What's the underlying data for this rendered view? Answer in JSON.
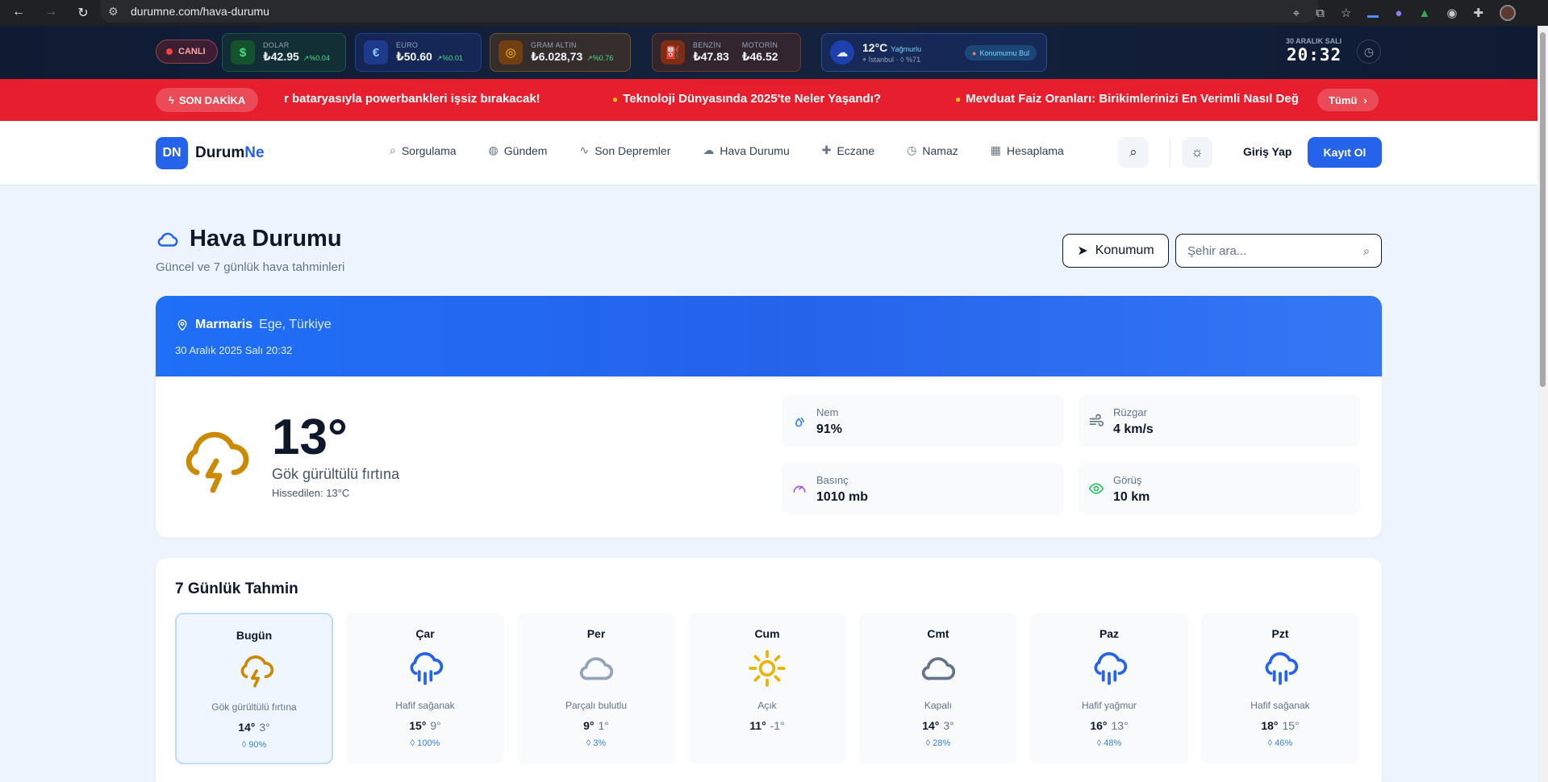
{
  "browser": {
    "url": "durumne.com/hava-durumu"
  },
  "ticker": {
    "live_label": "CANLI",
    "dollar": {
      "label": "DOLAR",
      "value": "₺42.95",
      "change": "%0.04",
      "symbol": "$"
    },
    "euro": {
      "label": "EURO",
      "value": "₺50.60",
      "change": "%0.01",
      "symbol": "€"
    },
    "gold": {
      "label": "GRAM ALTIN",
      "value": "₺6.028,73",
      "change": "%0.76"
    },
    "benzin": {
      "label": "BENZİN",
      "value": "₺47.83"
    },
    "motorin": {
      "label": "MOTORİN",
      "value": "₺46.52"
    },
    "weather": {
      "temp": "12°C",
      "condition": "Yağmurlu",
      "city": "İstanbul",
      "humidity": "%71",
      "locate_label": "Konumumu Bul"
    },
    "date": "30 ARALIK SALI",
    "time": "20:32"
  },
  "breaking": {
    "label": "SON DAKİKA",
    "items": [
      "r bataryasıyla powerbankleri işsiz bırakacak!",
      "Teknoloji Dünyasında 2025'te Neler Yaşandı?",
      "Mevduat Faiz Oranları: Birikimlerinizi En Verimli Nasıl Değ"
    ],
    "all_label": "Tümü"
  },
  "header": {
    "logo_mark": "DN",
    "logo_a": "Durum",
    "logo_b": "Ne",
    "nav": [
      "Sorgulama",
      "Gündem",
      "Son Depremler",
      "Hava Durumu",
      "Eczane",
      "Namaz",
      "Hesaplama"
    ],
    "login": "Giriş Yap",
    "register": "Kayıt Ol"
  },
  "page": {
    "title": "Hava Durumu",
    "subtitle": "Güncel ve 7 günlük hava tahminleri",
    "location_button": "Konumum",
    "search_placeholder": "Şehir ara..."
  },
  "current": {
    "city": "Marmaris",
    "region": "Ege, Türkiye",
    "datetime": "30 Aralık 2025 Salı 20:32",
    "temp": "13°",
    "condition": "Gök gürültülü fırtına",
    "feels_like": "Hissedilen: 13°C",
    "stats": {
      "humidity": {
        "label": "Nem",
        "value": "91%"
      },
      "wind": {
        "label": "Rüzgar",
        "value": "4 km/s"
      },
      "pressure": {
        "label": "Basınç",
        "value": "1010 mb"
      },
      "visibility": {
        "label": "Görüş",
        "value": "10 km"
      }
    },
    "colors": {
      "header_blue": "#2563eb",
      "storm_icon": "#ca8a04"
    }
  },
  "forecast": {
    "title": "7 Günlük Tahmin",
    "days": [
      {
        "day": "Bugün",
        "icon": "storm-icon",
        "condition": "Gök gürültülü fırtına",
        "high": "14°",
        "low": "3°",
        "rain": "90%"
      },
      {
        "day": "Çar",
        "icon": "rain-cloud-icon",
        "condition": "Hafif sağanak",
        "high": "15°",
        "low": "9°",
        "rain": "100%"
      },
      {
        "day": "Per",
        "icon": "cloud-icon",
        "condition": "Parçalı bulutlu",
        "high": "9°",
        "low": "1°",
        "rain": "3%"
      },
      {
        "day": "Cum",
        "icon": "sun-icon",
        "condition": "Açık",
        "high": "11°",
        "low": "-1°",
        "rain": ""
      },
      {
        "day": "Cmt",
        "icon": "cloud-icon",
        "condition": "Kapalı",
        "high": "14°",
        "low": "3°",
        "rain": "28%"
      },
      {
        "day": "Paz",
        "icon": "rain-cloud-icon",
        "condition": "Hafif yağmur",
        "high": "16°",
        "low": "13°",
        "rain": "48%"
      },
      {
        "day": "Pzt",
        "icon": "rain-cloud-icon",
        "condition": "Hafif sağanak",
        "high": "18°",
        "low": "15°",
        "rain": "46%"
      }
    ]
  }
}
